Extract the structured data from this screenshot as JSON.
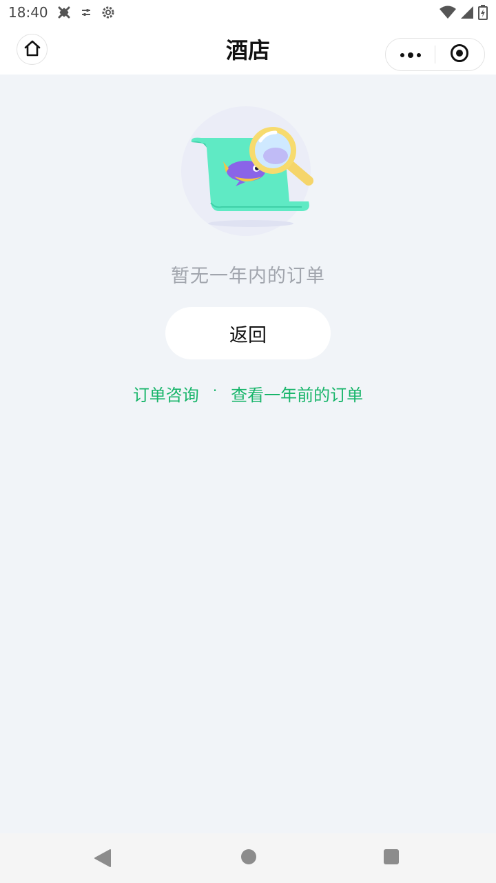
{
  "status_bar": {
    "time": "18:40",
    "icons_left": [
      "bug-icon",
      "tune-icon",
      "settings-icon"
    ],
    "icons_right": [
      "wifi-icon",
      "signal-icon",
      "battery-icon"
    ]
  },
  "header": {
    "title": "酒店",
    "home_icon": "home-icon",
    "more_icon": "more-dots-icon",
    "close_icon": "target-icon"
  },
  "empty_state": {
    "illustration": "document-magnifier-illustration",
    "message": "暂无一年内的订单",
    "back_label": "返回"
  },
  "links": {
    "consult": "订单咨询",
    "separator": "·",
    "older_orders": "查看一年前的订单"
  },
  "nav_bar": {
    "icons": [
      "back-triangle-icon",
      "home-circle-icon",
      "recents-square-icon"
    ]
  },
  "colors": {
    "background": "#f1f4f8",
    "accent_green": "#18b56a",
    "muted_text": "#a1a5ad"
  }
}
